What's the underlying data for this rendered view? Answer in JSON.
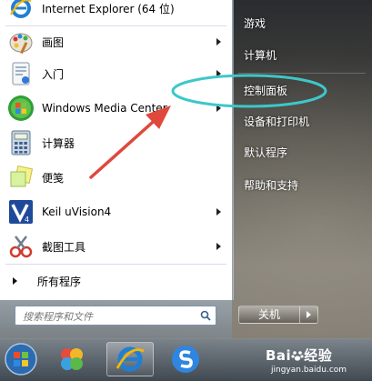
{
  "programs": [
    {
      "label": "Internet Explorer (64 位)",
      "icon": "internet-explorer-icon",
      "has_arrow": false
    },
    {
      "label": "画图",
      "icon": "paint-icon",
      "has_arrow": true
    },
    {
      "label": "入门",
      "icon": "getting-started-icon",
      "has_arrow": true
    },
    {
      "label": "Windows Media Center",
      "icon": "windows-media-center-icon",
      "has_arrow": true
    },
    {
      "label": "计算器",
      "icon": "calculator-icon",
      "has_arrow": false
    },
    {
      "label": "便笺",
      "icon": "sticky-notes-icon",
      "has_arrow": false
    },
    {
      "label": "Keil uVision4",
      "icon": "keil-uvision-icon",
      "has_arrow": true
    },
    {
      "label": "截图工具",
      "icon": "snipping-tool-icon",
      "has_arrow": true
    }
  ],
  "all_programs_label": "所有程序",
  "search": {
    "placeholder": "搜索程序和文件"
  },
  "right_items": [
    {
      "label": "游戏"
    },
    {
      "label": "计算机"
    },
    {
      "label": "控制面板"
    },
    {
      "label": "设备和打印机"
    },
    {
      "label": "默认程序"
    },
    {
      "label": "帮助和支持"
    }
  ],
  "shutdown_label": "关机",
  "taskbar": {
    "items": [
      "windows-start-icon",
      "colorful-app-icon",
      "internet-explorer-icon",
      "sogou-browser-icon"
    ]
  },
  "watermark": {
    "brand": "Bai",
    "brand_suffix": "经验",
    "url": "jingyan.baidu.com"
  },
  "colors": {
    "annotation": "#3ec7c9",
    "arrow": "#e0483c",
    "taskbar": "#4b5866"
  }
}
